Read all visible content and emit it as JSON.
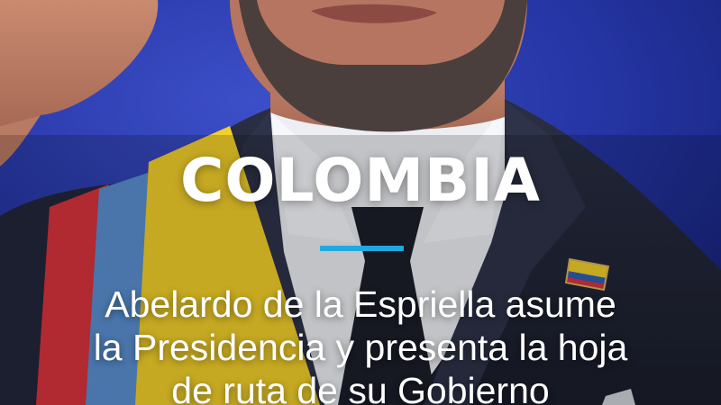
{
  "post": {
    "kicker": "COLOMBIA",
    "headline_lines": [
      "Abelardo de la Espriella asume",
      "la Presidencia y presenta la hoja",
      "de ruta de su Gobierno"
    ]
  },
  "colors": {
    "background": "#2637a6",
    "accent_rule": "#1fa9e1",
    "text": "#ffffff",
    "flag_yellow": "#f2cf2a",
    "flag_blue": "#5a8fd0",
    "flag_red": "#d8323c"
  },
  "icons": [
    "colombia-flag-pin-icon"
  ]
}
